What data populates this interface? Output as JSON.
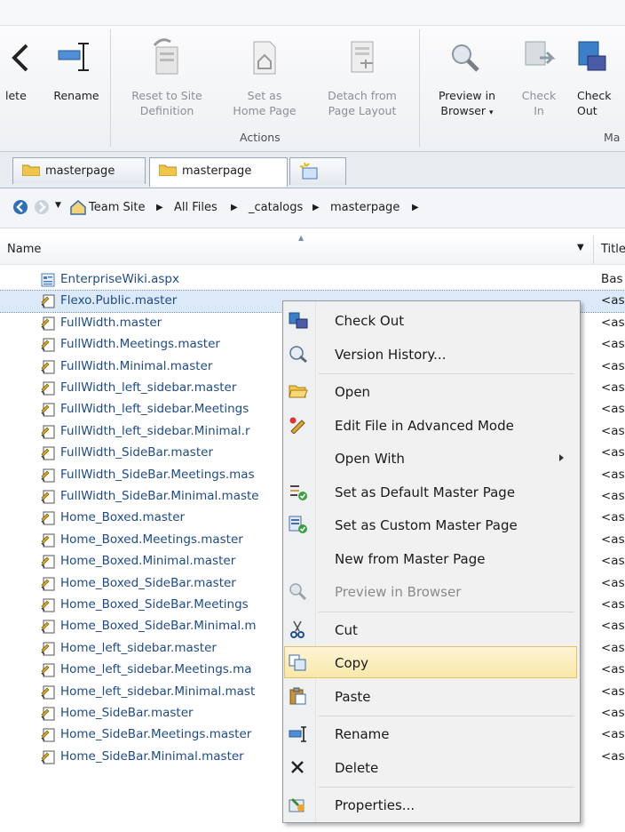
{
  "ribbon": {
    "buttons": [
      {
        "label": "lete",
        "icon": "delete-icon",
        "enabled": true
      },
      {
        "label": "Rename",
        "icon": "rename-icon",
        "enabled": true
      },
      {
        "label1": "Reset to Site",
        "label2": "Definition",
        "icon": "reset-page-icon",
        "enabled": false
      },
      {
        "label1": "Set as",
        "label2": "Home Page",
        "icon": "home-page-icon",
        "enabled": false
      },
      {
        "label1": "Detach from",
        "label2": "Page Layout",
        "icon": "detach-layout-icon",
        "enabled": false
      },
      {
        "label1": "Preview in",
        "label2": "Browser",
        "icon": "preview-icon",
        "enabled": true
      },
      {
        "label1": "Check",
        "label2": "In",
        "icon": "check-in-icon",
        "enabled": false
      },
      {
        "label1": "Check",
        "label2": "Out",
        "icon": "check-out-icon",
        "enabled": true
      }
    ],
    "group_actions": "Actions",
    "group_ma": "Ma"
  },
  "tabs": [
    {
      "label": "masterpage"
    },
    {
      "label": "masterpage"
    }
  ],
  "breadcrumb": [
    "Team Site",
    "All Files",
    "_catalogs",
    "masterpage"
  ],
  "columns": {
    "name": "Name",
    "title": "Title"
  },
  "files": [
    {
      "name": "EnterpriseWiki.aspx",
      "title": "Bas",
      "icon": "aspx-page-icon"
    },
    {
      "name": "Flexo.Public.master",
      "title": "<as",
      "icon": "master-page-icon",
      "selected": true
    },
    {
      "name": "FullWidth.master",
      "title": "<as",
      "icon": "master-page-icon"
    },
    {
      "name": "FullWidth.Meetings.master",
      "title": "<as",
      "icon": "master-page-icon"
    },
    {
      "name": "FullWidth.Minimal.master",
      "title": "<as",
      "icon": "master-page-icon"
    },
    {
      "name": "FullWidth_left_sidebar.master",
      "title": "<as",
      "icon": "master-page-icon"
    },
    {
      "name": "FullWidth_left_sidebar.Meetings",
      "title": "<as",
      "icon": "master-page-icon"
    },
    {
      "name": "FullWidth_left_sidebar.Minimal.r",
      "title": "<as",
      "icon": "master-page-icon"
    },
    {
      "name": "FullWidth_SideBar.master",
      "title": "<as",
      "icon": "master-page-icon"
    },
    {
      "name": "FullWidth_SideBar.Meetings.mas",
      "title": "<as",
      "icon": "master-page-icon"
    },
    {
      "name": "FullWidth_SideBar.Minimal.maste",
      "title": "<as",
      "icon": "master-page-icon"
    },
    {
      "name": "Home_Boxed.master",
      "title": "<as",
      "icon": "master-page-icon"
    },
    {
      "name": "Home_Boxed.Meetings.master",
      "title": "<as",
      "icon": "master-page-icon"
    },
    {
      "name": "Home_Boxed.Minimal.master",
      "title": "<as",
      "icon": "master-page-icon"
    },
    {
      "name": "Home_Boxed_SideBar.master",
      "title": "<as",
      "icon": "master-page-icon"
    },
    {
      "name": "Home_Boxed_SideBar.Meetings",
      "title": "<as",
      "icon": "master-page-icon"
    },
    {
      "name": "Home_Boxed_SideBar.Minimal.m",
      "title": "<as",
      "icon": "master-page-icon"
    },
    {
      "name": "Home_left_sidebar.master",
      "title": "<as",
      "icon": "master-page-icon"
    },
    {
      "name": "Home_left_sidebar.Meetings.ma",
      "title": "<as",
      "icon": "master-page-icon"
    },
    {
      "name": "Home_left_sidebar.Minimal.mast",
      "title": "<as",
      "icon": "master-page-icon"
    },
    {
      "name": "Home_SideBar.master",
      "title": "<as",
      "icon": "master-page-icon"
    },
    {
      "name": "Home_SideBar.Meetings.master",
      "title": "<as",
      "icon": "master-page-icon"
    },
    {
      "name": "Home_SideBar.Minimal.master",
      "title": "<as",
      "icon": "master-page-icon"
    }
  ],
  "context_menu": [
    {
      "label": "Check Out",
      "icon": "check-out-icon"
    },
    {
      "label": "Version History...",
      "icon": "version-history-icon"
    },
    {
      "sep": true
    },
    {
      "label": "Open",
      "icon": "open-folder-icon"
    },
    {
      "label": "Edit File in Advanced Mode",
      "icon": "edit-advanced-icon"
    },
    {
      "label": "Open With",
      "submenu": true
    },
    {
      "label": "Set as Default Master Page",
      "icon": "set-default-master-icon"
    },
    {
      "label": "Set as Custom Master Page",
      "icon": "set-custom-master-icon"
    },
    {
      "label": "New from Master Page"
    },
    {
      "label": "Preview in Browser",
      "icon": "preview-icon",
      "disabled": true
    },
    {
      "sep": true
    },
    {
      "label": "Cut",
      "icon": "cut-icon"
    },
    {
      "label": "Copy",
      "icon": "copy-icon",
      "hover": true
    },
    {
      "label": "Paste",
      "icon": "paste-icon"
    },
    {
      "sep": true
    },
    {
      "label": "Rename",
      "icon": "rename-icon"
    },
    {
      "label": "Delete",
      "icon": "delete-icon"
    },
    {
      "sep": true
    },
    {
      "label": "Properties...",
      "icon": "properties-icon"
    }
  ],
  "colors": {
    "accent": "#1e4a8a",
    "hover": "#f8e8a8",
    "selected": "#dce9f8"
  }
}
